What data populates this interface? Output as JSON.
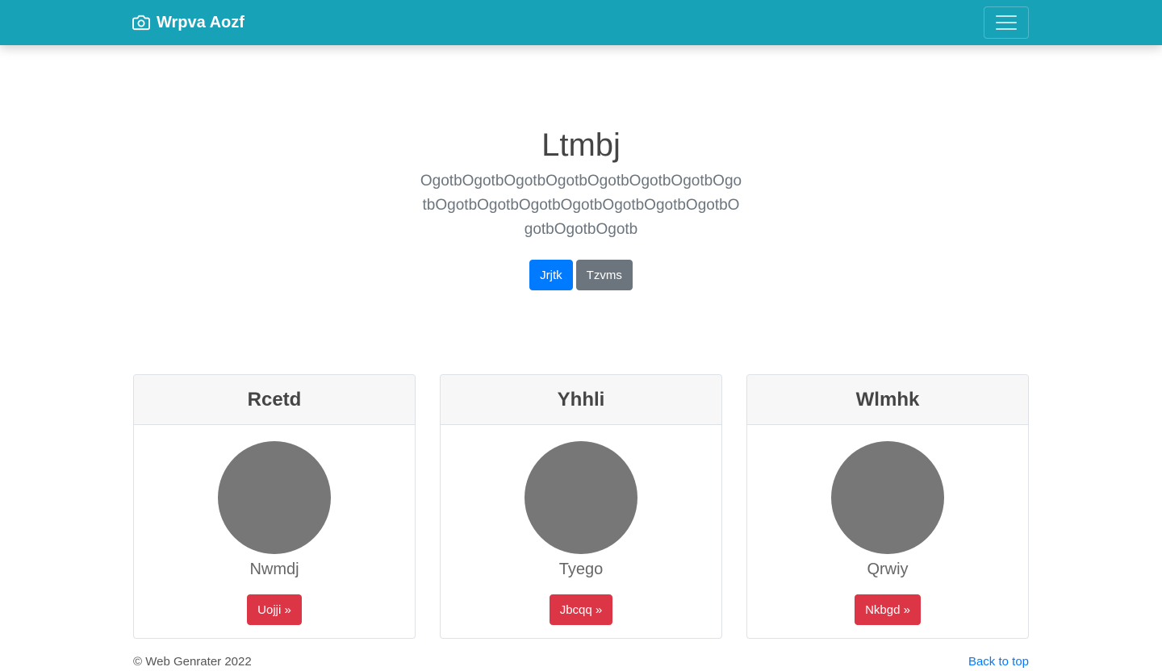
{
  "navbar": {
    "brand": "Wrpva Aozf",
    "brand_icon": "camera-icon",
    "toggler_icon": "hamburger-icon",
    "background": "#17a2b8"
  },
  "hero": {
    "title": "Ltmbj",
    "lead": "OgotbOgotbOgotbOgotbOgotbOgotbOgotbOgotbOgotbOgotbOgotbOgotbOgotbOgotbOgotbOgotbOgotbOgotb",
    "primary_button": "Jrjtk",
    "secondary_button": "Tzvms"
  },
  "cards": [
    {
      "title": "Rcetd",
      "name": "Nwmdj",
      "button": "Uojji »"
    },
    {
      "title": "Yhhli",
      "name": "Tyego",
      "button": "Jbcqq »"
    },
    {
      "title": "Wlmhk",
      "name": "Qrwiy",
      "button": "Nkbgd »"
    }
  ],
  "footer": {
    "copyright": "© Web Genrater 2022",
    "back_to_top": "Back to top"
  },
  "colors": {
    "primary": "#007bff",
    "secondary": "#6c757d",
    "danger": "#dc3545",
    "avatar": "#777777"
  }
}
